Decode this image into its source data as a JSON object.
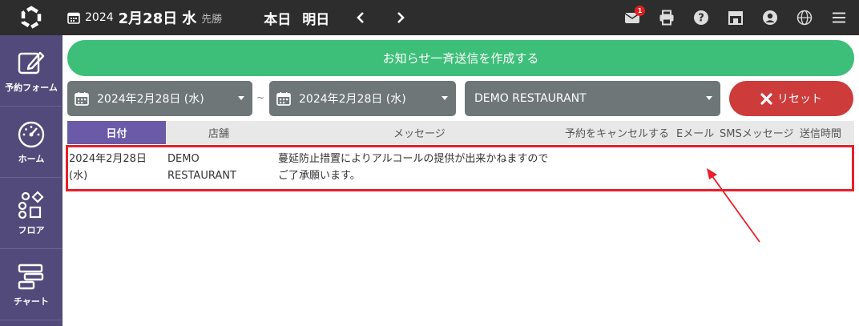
{
  "header": {
    "year": "2024",
    "month_day": "2月28日",
    "weekday": "水",
    "rokuyo": "先勝",
    "today_label": "本日",
    "tomorrow_label": "明日",
    "mail_badge_count": "1"
  },
  "sidebar": {
    "items": [
      {
        "label": "予約フォーム",
        "icon": "edit-icon"
      },
      {
        "label": "ホーム",
        "icon": "dashboard-gauge-icon"
      },
      {
        "label": "フロア",
        "icon": "floor-shapes-icon"
      },
      {
        "label": "チャート",
        "icon": "chart-bars-icon"
      }
    ]
  },
  "compose_button_label": "お知らせ一斉送信を作成する",
  "filters": {
    "date_from": "2024年2月28日 (水)",
    "separator": "~",
    "date_to": "2024年2月28日 (水)",
    "store": "DEMO RESTAURANT",
    "reset_label": "リセット"
  },
  "table": {
    "headers": {
      "date": "日付",
      "store": "店舗",
      "message": "メッセージ",
      "cancel": "予約をキャンセルする",
      "email": "Eメール",
      "sms": "SMSメッセージ",
      "sent_time": "送信時間"
    },
    "rows": [
      {
        "date_line1": "2024年2月28日",
        "date_line2": "(水)",
        "store_line1": "DEMO",
        "store_line2": "RESTAURANT",
        "message_line1": "蔓延防止措置によりアルコールの提供が出来かねますので",
        "message_line2": "ご了承願います。"
      }
    ]
  },
  "colors": {
    "topbar": "#2d2d2d",
    "sidebar": "#524a7a",
    "compose_green": "#3dbf79",
    "dropdown_gray": "#6e7678",
    "reset_red": "#cd3b3b",
    "active_tab": "#6a5aa8",
    "highlight_red": "#e8202a"
  }
}
